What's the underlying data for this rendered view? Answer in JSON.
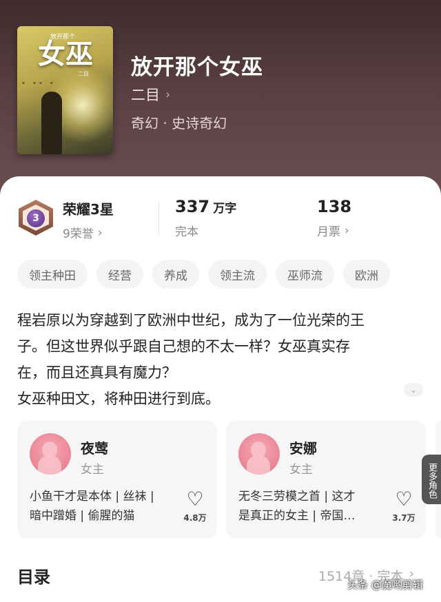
{
  "header": {
    "cover": {
      "title": "女巫",
      "sub": "放开那个",
      "author_small": "二目"
    },
    "title": "放开那个女巫",
    "author": "二目",
    "author_chevron": "›",
    "genre": "奇幻 · 史诗奇幻"
  },
  "stats": {
    "badge_number": "3",
    "honor_title": "荣耀3星",
    "honor_count": "9荣誉",
    "words_number": "337",
    "words_unit": "万字",
    "status": "完本",
    "tickets": "138",
    "tickets_label": "月票",
    "chevron": "›"
  },
  "tags": [
    "领主种田",
    "经营",
    "养成",
    "领主流",
    "巫师流",
    "欧洲"
  ],
  "description": {
    "lines": [
      "程岩原以为穿越到了欧洲中世纪，成为了一位光荣的王",
      "子。但这世界似乎跟自己想的不太一样？女巫真实存",
      "在，而且还真具有魔力？",
      "女巫种田文，将种田进行到底。"
    ],
    "expand_icon": "⌄"
  },
  "characters": [
    {
      "name": "夜莺",
      "role": "女主",
      "desc_lines": [
        "小鱼干才是本体 | 丝袜 |",
        "暗中蹭婚 | 偷腥的猫"
      ],
      "likes": "4.8万"
    },
    {
      "name": "安娜",
      "role": "女主",
      "desc_lines": [
        "无冬三劳模之首 | 这才",
        "是真正的女主 | 帝国…"
      ],
      "likes": "3.7万"
    }
  ],
  "more_roles": "更多角色",
  "heart_icon": "♡",
  "toc": {
    "title": "目录",
    "meta": "1514章 · 完本",
    "chevron": "›"
  },
  "watermark": "头条 @魔哟剪辑"
}
